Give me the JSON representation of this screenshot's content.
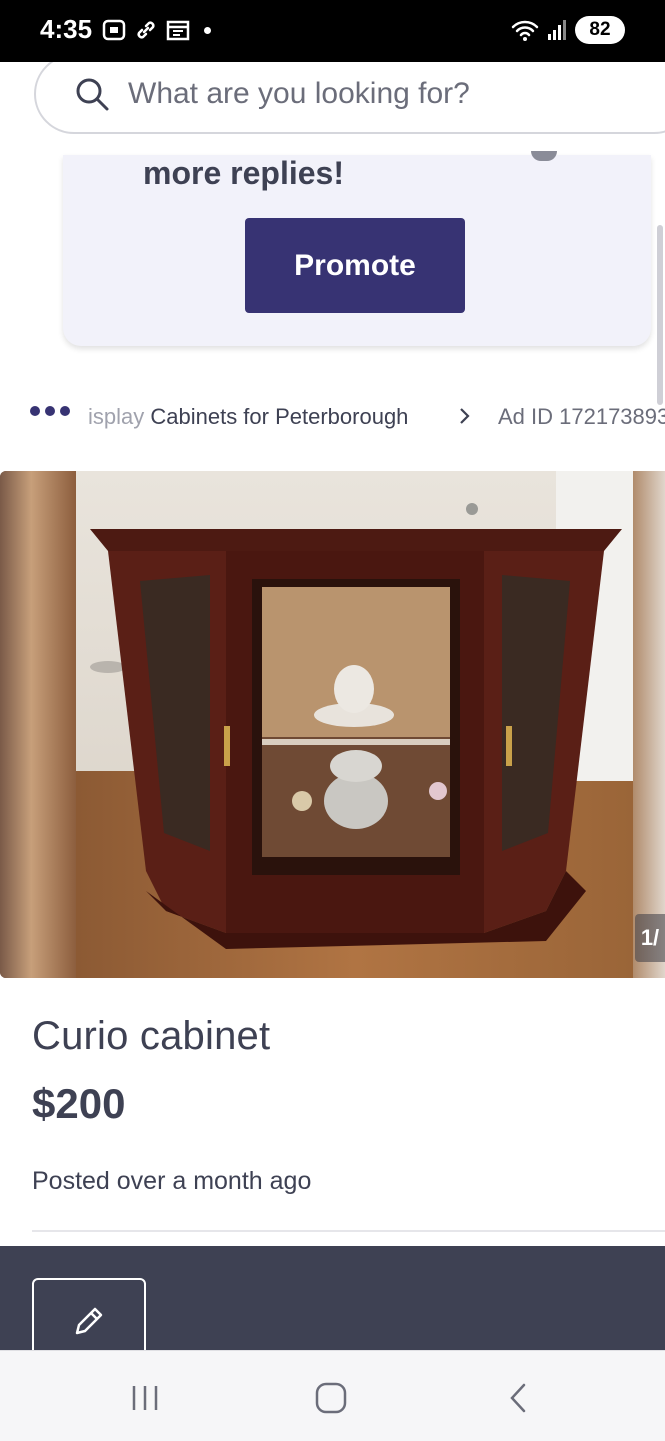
{
  "status_bar": {
    "time": "4:35",
    "battery": "82",
    "icons": [
      "screenshot-icon",
      "link-icon",
      "calendar-icon",
      "notification-dot",
      "wifi-icon",
      "signal-icon"
    ]
  },
  "search": {
    "placeholder": "What are you looking for?"
  },
  "promo": {
    "text": "more replies!",
    "button_label": "Promote"
  },
  "breadcrumb": {
    "category_faded": "isplay",
    "category_rest": " Cabinets for Peterborough",
    "ad_id": "Ad ID 172173893"
  },
  "listing": {
    "photo_counter": "1/",
    "title": "Curio cabinet",
    "price": "$200",
    "posted": "Posted over a month ago"
  },
  "colors": {
    "brand": "#373373",
    "text": "#3e4153",
    "panel": "#3e4153",
    "promo_bg": "#f2f2fa"
  }
}
